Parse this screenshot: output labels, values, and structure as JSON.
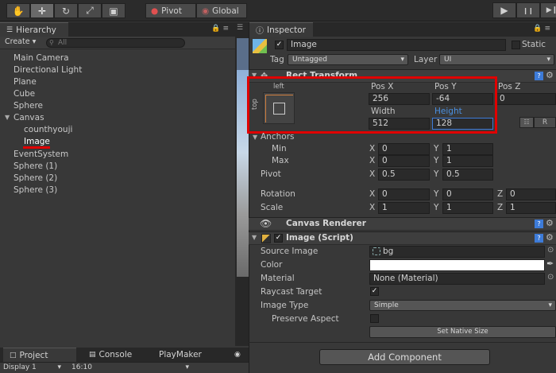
{
  "toolbar": {
    "tools": [
      "hand-icon",
      "move-icon",
      "rotate-icon",
      "scale-icon",
      "rect-tool-icon"
    ],
    "tool_glyphs": [
      "✋",
      "✛",
      "↻",
      "⤢",
      "▣"
    ],
    "pivot_label": "Pivot",
    "global_label": "Global",
    "play_glyphs": [
      "▶",
      "❙❙",
      "▶❙"
    ]
  },
  "hierarchy": {
    "tab_label": "Hierarchy",
    "create_label": "Create",
    "search_placeholder": "All",
    "items": [
      {
        "label": "Main Camera",
        "indent": 0
      },
      {
        "label": "Directional Light",
        "indent": 0
      },
      {
        "label": "Plane",
        "indent": 0
      },
      {
        "label": "Cube",
        "indent": 0
      },
      {
        "label": "Sphere",
        "indent": 0
      },
      {
        "label": "Canvas",
        "indent": 0,
        "expanded": true
      },
      {
        "label": "counthyouji",
        "indent": 1
      },
      {
        "label": "Image",
        "indent": 1,
        "selected": true
      },
      {
        "label": "EventSystem",
        "indent": 0
      },
      {
        "label": "Sphere (1)",
        "indent": 0
      },
      {
        "label": "Sphere (2)",
        "indent": 0
      },
      {
        "label": "Sphere (3)",
        "indent": 0
      }
    ]
  },
  "bottom_tabs": {
    "project": "Project",
    "console": "Console",
    "playmaker": "PlayMaker",
    "display": "Display 1",
    "aspect": "16:10"
  },
  "inspector": {
    "tab_label": "Inspector",
    "object_name": "Image",
    "static_label": "Static",
    "tag_label": "Tag",
    "tag_value": "Untagged",
    "layer_label": "Layer",
    "layer_value": "UI",
    "rect_transform": {
      "title": "Rect Transform",
      "anchor_h": "left",
      "anchor_v": "top",
      "pos_x_label": "Pos X",
      "pos_x": "256",
      "pos_y_label": "Pos Y",
      "pos_y": "-64",
      "pos_z_label": "Pos Z",
      "pos_z": "0",
      "width_label": "Width",
      "width": "512",
      "height_label": "Height",
      "height": "128",
      "r_label": "R",
      "anchors_label": "Anchors",
      "min_label": "Min",
      "min_x": "0",
      "min_y": "1",
      "max_label": "Max",
      "max_x": "0",
      "max_y": "1",
      "pivot_label": "Pivot",
      "pivot_x": "0.5",
      "pivot_y": "0.5",
      "rotation_label": "Rotation",
      "rot_x": "0",
      "rot_y": "0",
      "rot_z": "0",
      "scale_label": "Scale",
      "scale_x": "1",
      "scale_y": "1",
      "scale_z": "1",
      "x": "X",
      "y": "Y",
      "z": "Z"
    },
    "canvas_renderer": {
      "title": "Canvas Renderer"
    },
    "image_script": {
      "title": "Image (Script)",
      "source_image_label": "Source Image",
      "source_image_value": "bg",
      "color_label": "Color",
      "material_label": "Material",
      "material_value": "None (Material)",
      "raycast_label": "Raycast Target",
      "image_type_label": "Image Type",
      "image_type_value": "Simple",
      "preserve_label": "Preserve Aspect",
      "set_native_label": "Set Native Size"
    },
    "add_component_label": "Add Component"
  },
  "colors": {
    "highlight_red": "#e00000",
    "height_label_blue": "#4a8fe0"
  }
}
